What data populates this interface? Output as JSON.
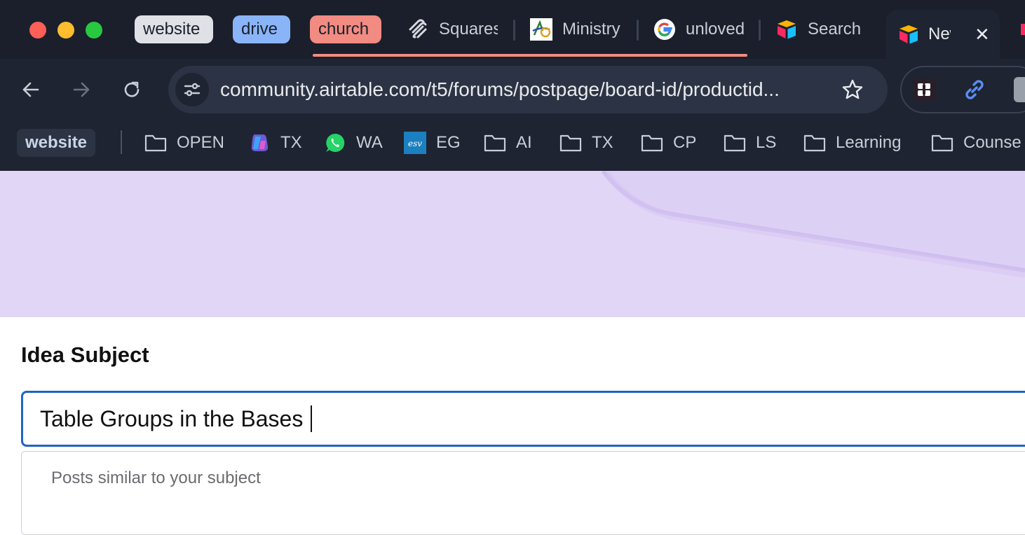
{
  "browser": {
    "tab_groups": [
      {
        "label": "website",
        "color": "#dfe1e6"
      },
      {
        "label": "drive",
        "color": "#8ab4f8"
      },
      {
        "label": "church",
        "color": "#f28b82"
      }
    ],
    "tabs": [
      {
        "label": "Squarespace",
        "icon": "squarespace-icon"
      },
      {
        "label": "Ministry",
        "icon": "ministry-logo-icon"
      },
      {
        "label": "unloved",
        "icon": "google-icon"
      },
      {
        "label": "Search",
        "icon": "airtable-icon"
      }
    ],
    "active_tab": {
      "label": "New",
      "icon": "airtable-icon"
    },
    "url": "community.airtable.com/t5/forums/postpage/board-id/productid...",
    "bookmarks_group_label": "website",
    "bookmarks": [
      {
        "label": "OPEN",
        "icon": "folder-icon"
      },
      {
        "label": "TX",
        "icon": "copilot-icon"
      },
      {
        "label": "WA",
        "icon": "whatsapp-icon"
      },
      {
        "label": "EG",
        "icon": "esv-icon"
      },
      {
        "label": "AI",
        "icon": "folder-icon"
      },
      {
        "label": "TX",
        "icon": "folder-icon"
      },
      {
        "label": "CP",
        "icon": "folder-icon"
      },
      {
        "label": "LS",
        "icon": "folder-icon"
      },
      {
        "label": "Learning",
        "icon": "folder-icon"
      },
      {
        "label": "Counse",
        "icon": "folder-icon"
      }
    ]
  },
  "form": {
    "subject_label": "Idea Subject",
    "subject_value": "Table Groups in the Bases",
    "similar_posts_label": "Posts similar to your subject"
  },
  "colors": {
    "accent": "#1f63c6",
    "hero_background": "#e2d6f6",
    "chrome_background": "#1e2432"
  }
}
